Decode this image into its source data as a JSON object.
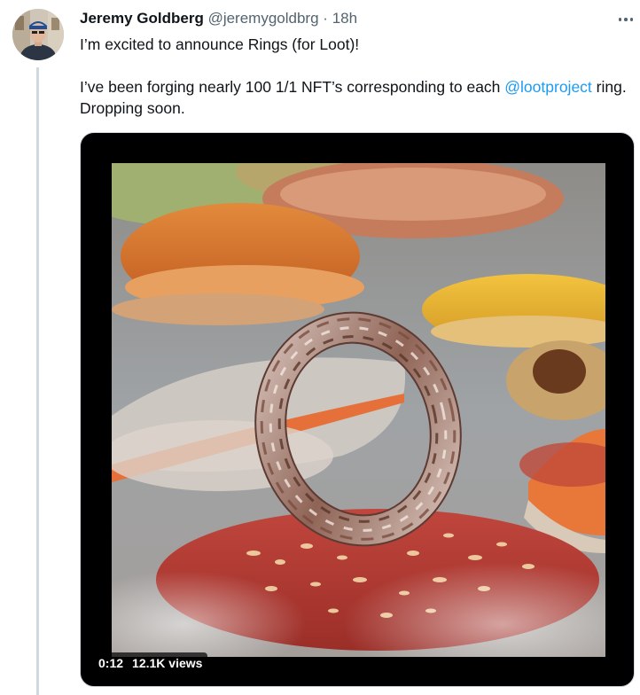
{
  "tweet": {
    "author_name": "Jeremy Goldberg",
    "handle": "@jeremygoldbrg",
    "separator": "·",
    "time": "18h",
    "line1": "I’m excited to announce Rings (for Loot)!",
    "line2_before": "I’ve been forging nearly 100 1/1 NFT’s corresponding to each ",
    "mention": "@lootproject",
    "line2_after": " ring. Dropping soon."
  },
  "video": {
    "duration": "0:12",
    "views": "12.1K views"
  },
  "icons": {
    "more": "more-horizontal-icon"
  },
  "colors": {
    "accent": "#1d9bf0",
    "secondary_text": "#536471",
    "thread_line": "#cfd9de"
  }
}
